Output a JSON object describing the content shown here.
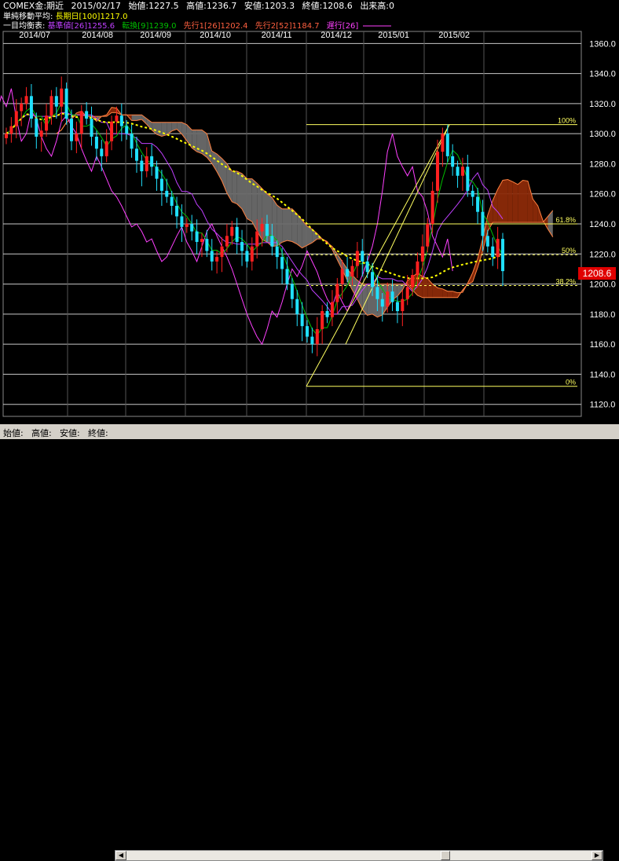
{
  "header": {
    "symbol": "COMEX金:期近",
    "date": "2015/02/17",
    "open_label": "始値:",
    "open": "1227.5",
    "high_label": "高値:",
    "high": "1236.7",
    "low_label": "安値:",
    "low": "1203.3",
    "close_label": "終値:",
    "close": "1208.6",
    "volume_label": "出来高:",
    "volume": "0"
  },
  "ma": {
    "label": "単純移動平均:",
    "long_label": "長期日[100]",
    "long_value": "1217.0"
  },
  "ichimoku": {
    "label": "一目均衡表:",
    "kijun_label": "基準値[26]",
    "kijun_value": "1255.6",
    "tenkan_label": "転換[9]",
    "tenkan_value": "1239.0",
    "senkou1_label": "先行1[26]",
    "senkou1_value": "1202.4",
    "senkou2_label": "先行2[52]",
    "senkou2_value": "1184.7",
    "chikou_label": "遅行[26]"
  },
  "colors": {
    "kijun": "#c040ff",
    "tenkan": "#00c000",
    "senkou1": "#ff8040",
    "senkou2": "#ff8040",
    "chikou": "#ff40ff",
    "ma": "#ffff00",
    "up": "#ff2020",
    "down": "#20e0ff",
    "price_tag": "#e00000",
    "fib": "#ffff60"
  },
  "current_price": "1208.6",
  "fib_labels": [
    "100%",
    "61.8%",
    "50%",
    "38.2%",
    "0%"
  ],
  "chart_data": {
    "type": "candlestick",
    "x_ticks": [
      "2014/07",
      "2014/08",
      "2014/09",
      "2014/10",
      "2014/11",
      "2014/12",
      "2015/01",
      "2015/02"
    ],
    "y_ticks": [
      1120.0,
      1140.0,
      1160.0,
      1180.0,
      1200.0,
      1220.0,
      1240.0,
      1260.0,
      1280.0,
      1300.0,
      1320.0,
      1340.0,
      1360.0
    ],
    "ylim": [
      1112,
      1368
    ],
    "fib_levels": [
      1306,
      1240,
      1219.5,
      1199,
      1132
    ],
    "close_series": [
      1300,
      1305,
      1315,
      1320,
      1325,
      1310,
      1298,
      1302,
      1312,
      1325,
      1318,
      1330,
      1310,
      1295,
      1300,
      1315,
      1310,
      1298,
      1290,
      1285,
      1295,
      1308,
      1312,
      1305,
      1300,
      1290,
      1282,
      1275,
      1285,
      1278,
      1270,
      1262,
      1258,
      1252,
      1245,
      1238,
      1240,
      1235,
      1228,
      1230,
      1222,
      1215,
      1218,
      1225,
      1232,
      1238,
      1228,
      1222,
      1215,
      1225,
      1235,
      1240,
      1232,
      1225,
      1218,
      1210,
      1200,
      1190,
      1180,
      1172,
      1165,
      1160,
      1170,
      1182,
      1178,
      1188,
      1200,
      1210,
      1205,
      1212,
      1222,
      1215,
      1208,
      1198,
      1190,
      1185,
      1195,
      1188,
      1182,
      1190,
      1198,
      1206,
      1215,
      1225,
      1240,
      1262,
      1288,
      1300,
      1285,
      1278,
      1272,
      1278,
      1262,
      1258,
      1248,
      1232,
      1225,
      1218,
      1230,
      1208.6
    ]
  }
}
